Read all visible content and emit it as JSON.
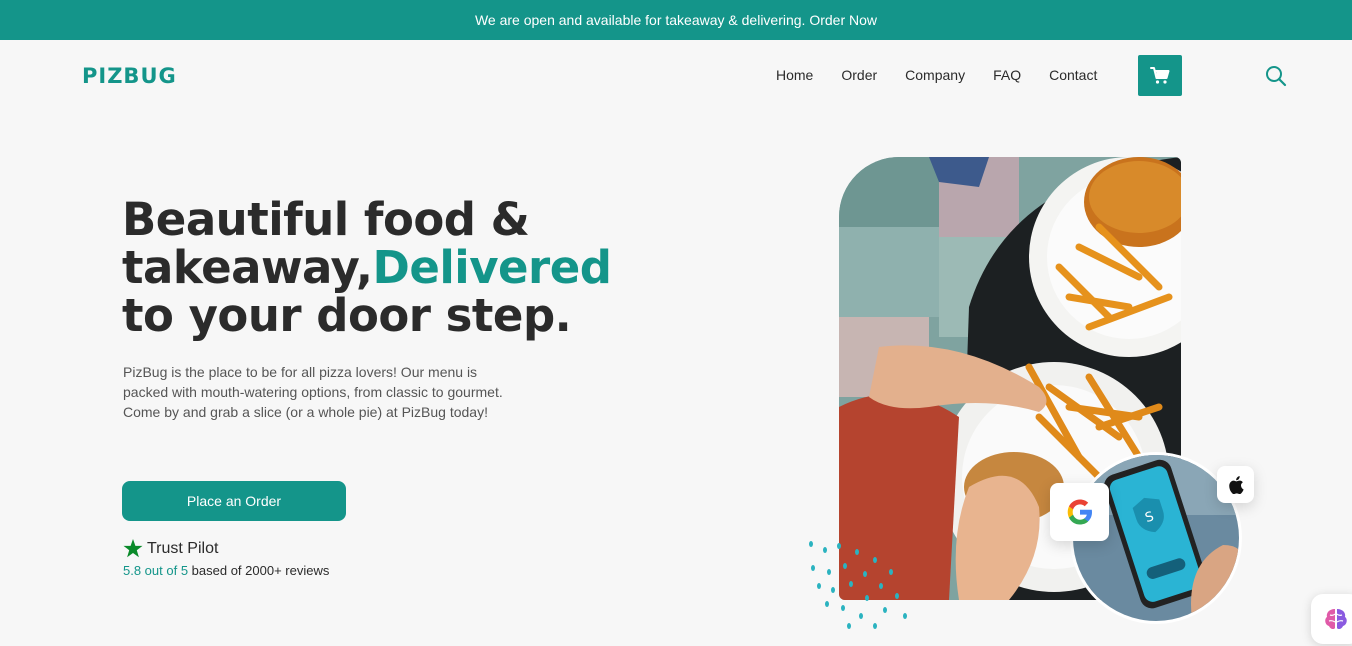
{
  "topbar": {
    "text": "We are open and available for takeaway & delivering. Order Now"
  },
  "header": {
    "logo": "PIZBUG",
    "nav": [
      {
        "label": "Home"
      },
      {
        "label": "Order"
      },
      {
        "label": "Company"
      },
      {
        "label": "FAQ"
      },
      {
        "label": "Contact"
      }
    ],
    "cart_icon": "shopping-cart-icon",
    "search_icon": "search-icon"
  },
  "hero": {
    "title_line1": "Beautiful food &",
    "title_line2_plain": "takeaway,",
    "title_line2_accent": "Delivered",
    "title_line3": "to your door step.",
    "description": "PizBug is the place to be for all pizza lovers! Our menu is packed with mouth-watering options, from classic to gourmet. Come by and grab a slice (or a whole pie) at PizBug today!",
    "order_button": "Place an Order",
    "trust_label": "Trust Pilot",
    "rating_score": "5.8 out of 5",
    "rating_text": " based of 2000+ reviews"
  },
  "badges": {
    "google": "google-icon",
    "apple": "apple-icon"
  },
  "colors": {
    "accent": "#14958a",
    "star": "#0a8a2a",
    "background": "#f7f7f7"
  }
}
